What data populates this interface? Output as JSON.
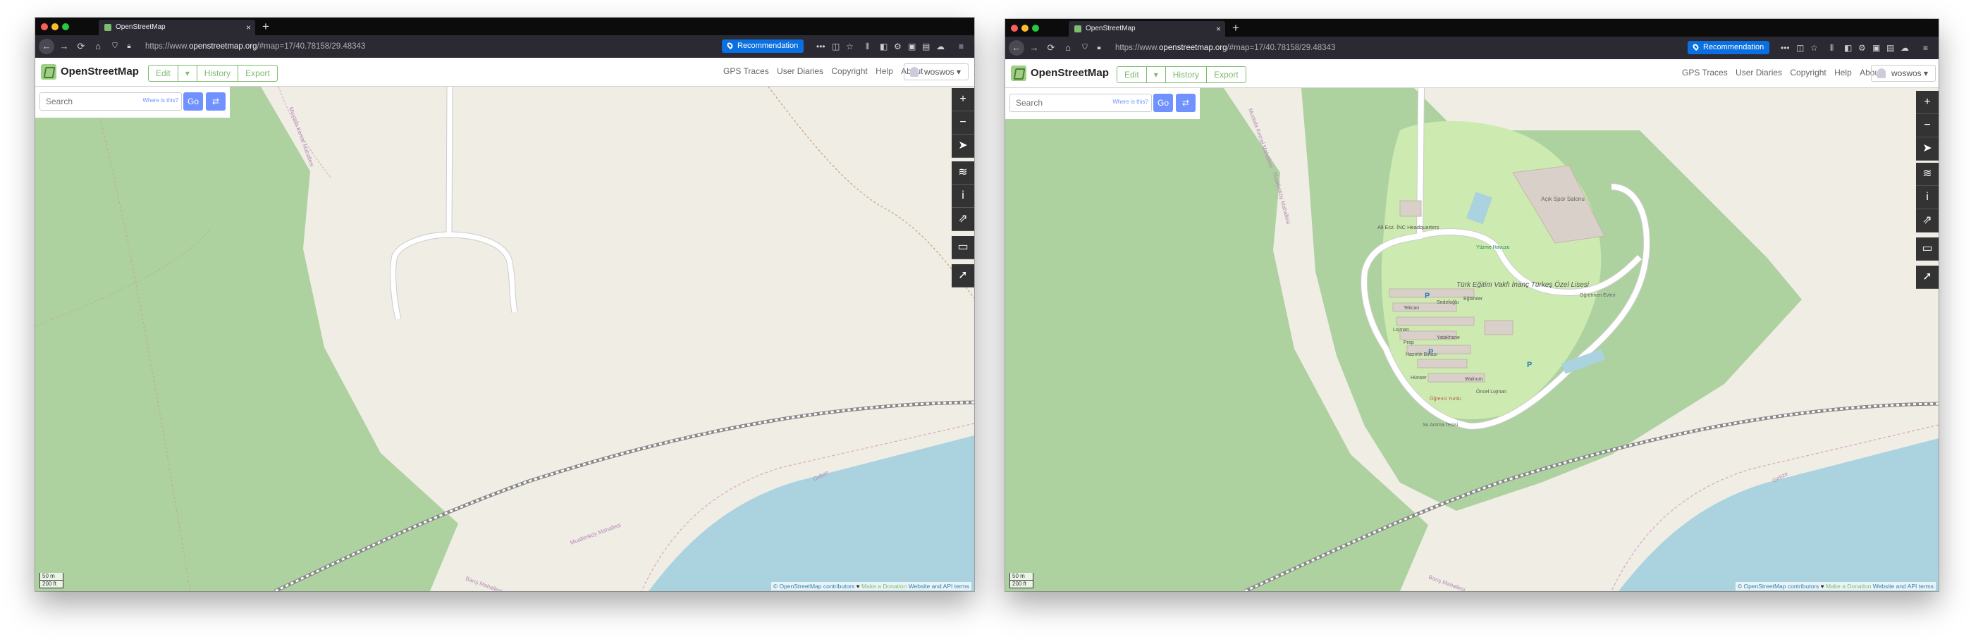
{
  "browser": {
    "tab_title": "OpenStreetMap",
    "tab_close": "×",
    "new_tab": "+",
    "back": "←",
    "forward": "→",
    "reload": "⟳",
    "home": "⌂",
    "url_prefix": "https://www.",
    "url_host": "openstreetmap.org",
    "url_path": "/#map=17/40.78158/29.48343",
    "recommendation": "Recommendation",
    "more": "•••",
    "menu": "≡"
  },
  "osm": {
    "brand": "OpenStreetMap",
    "edit": "Edit",
    "edit_caret": "▾",
    "history": "History",
    "export": "Export",
    "nav_links": [
      "GPS Traces",
      "User Diaries",
      "Copyright",
      "Help",
      "About"
    ],
    "user": "woswos ▾",
    "search_placeholder": "Search",
    "where_is_this": "Where is this?",
    "go": "Go",
    "directions": "⇄"
  },
  "map_controls": [
    "+",
    "−",
    "➤",
    "≋",
    "i",
    "⇗",
    "▭",
    "➚"
  ],
  "scale": {
    "metric": "50 m",
    "imperial": "200 ft"
  },
  "attribution": {
    "contributors": "© OpenStreetMap contributors",
    "heart": "♥",
    "donation": "Make a Donation",
    "terms": "Website and API terms"
  },
  "map_labels": {
    "street1": "Mustafa Kemal Mahallesi",
    "street2": "Muallimköy Mahallesi",
    "street3": "Gebze",
    "street4": "Barış Mahallesi",
    "sports": "Açık Spor Salonu",
    "hq": "Ali Ecz. İNC Headquarters",
    "pool": "Yüzme Havuzu",
    "school": "Türk Eğitim Vakfı İnanç Türkeş Özel Lisesi",
    "bldg1": "Öğretmen Evleri",
    "bldg2": "Tekcan",
    "bldg3": "Sedefoğlu",
    "bldg4": "Eğitimler",
    "bldg5": "Lojman",
    "bldg6": "Prep",
    "bldg7": "Yatakhane",
    "bldg8": "Hazırlık Binası",
    "bldg9": "Hünser",
    "bldg10": "Walnum",
    "bldg11": "Öncel Lojman",
    "bldg12": "Öğrenci Yurdu",
    "bldg13": "Su Arıtma Tesisi",
    "parking": "P"
  }
}
